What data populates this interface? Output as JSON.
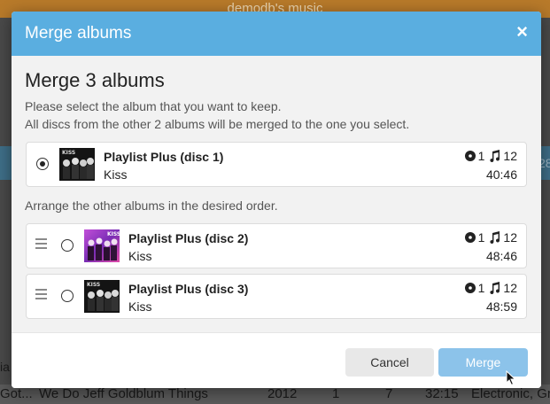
{
  "background": {
    "app_title": "demodb's music",
    "partial_row": {
      "left": "Got...",
      "title": "We Do Jeff Goldblum Things",
      "year": "2012",
      "disc": "1",
      "tracks": "7",
      "duration": "32:15",
      "genre": "Electronic, Grin"
    },
    "partial_row_above": "ia",
    "edge_number": "28"
  },
  "modal": {
    "title": "Merge albums",
    "close_symbol": "×",
    "heading": "Merge 3 albums",
    "instructions_line1": "Please select the album that you want to keep.",
    "instructions_line2": "All discs from the other 2 albums will be merged to the one you select.",
    "arrange_hint": "Arrange the other albums in the desired order.",
    "selected_album": {
      "name": "Playlist Plus (disc 1)",
      "artist": "Kiss",
      "discs": "1",
      "tracks": "12",
      "duration": "40:46"
    },
    "other_albums": [
      {
        "name": "Playlist Plus (disc 2)",
        "artist": "Kiss",
        "discs": "1",
        "tracks": "12",
        "duration": "48:46"
      },
      {
        "name": "Playlist Plus (disc 3)",
        "artist": "Kiss",
        "discs": "1",
        "tracks": "12",
        "duration": "48:59"
      }
    ],
    "buttons": {
      "cancel": "Cancel",
      "merge": "Merge"
    }
  },
  "colors": {
    "header": "#5aaee0",
    "merge_button": "#8cc3ea",
    "cancel_button": "#e8e8e8"
  }
}
